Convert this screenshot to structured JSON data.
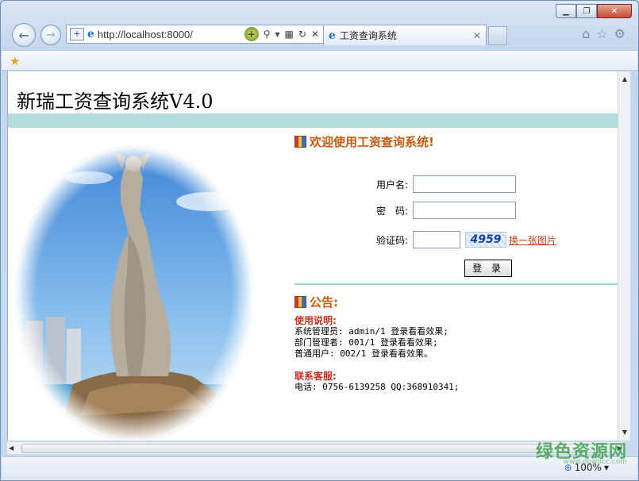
{
  "browser": {
    "address": "http://localhost:8000/",
    "tab_title": "工资查询系统",
    "zoom": "100%",
    "min_label": "▁",
    "max_label": "❐",
    "close_label": "✕"
  },
  "page": {
    "site_title": "新瑞工资查询系统V4.0",
    "welcome": "欢迎使用工资查询系统!",
    "form": {
      "username_label": "用户名:",
      "password_label": "密　码:",
      "captcha_label": "验证码:",
      "captcha_value": "4959",
      "refresh_link": "换一张图片",
      "login_button": "登 录"
    },
    "notice_title": "公告:",
    "usage_heading": "使用说明:",
    "usage_lines": [
      "系统管理员: admin/1 登录看看效果;",
      "部门管理者: 001/1 登录看看效果;",
      "普通用户: 002/1 登录看看效果。"
    ],
    "support_heading": "联系客服:",
    "support_line": "电话: 0756-6139258 QQ:368910341;"
  },
  "watermark": {
    "text": "绿色资源网",
    "sub": "www.downcc.com"
  }
}
